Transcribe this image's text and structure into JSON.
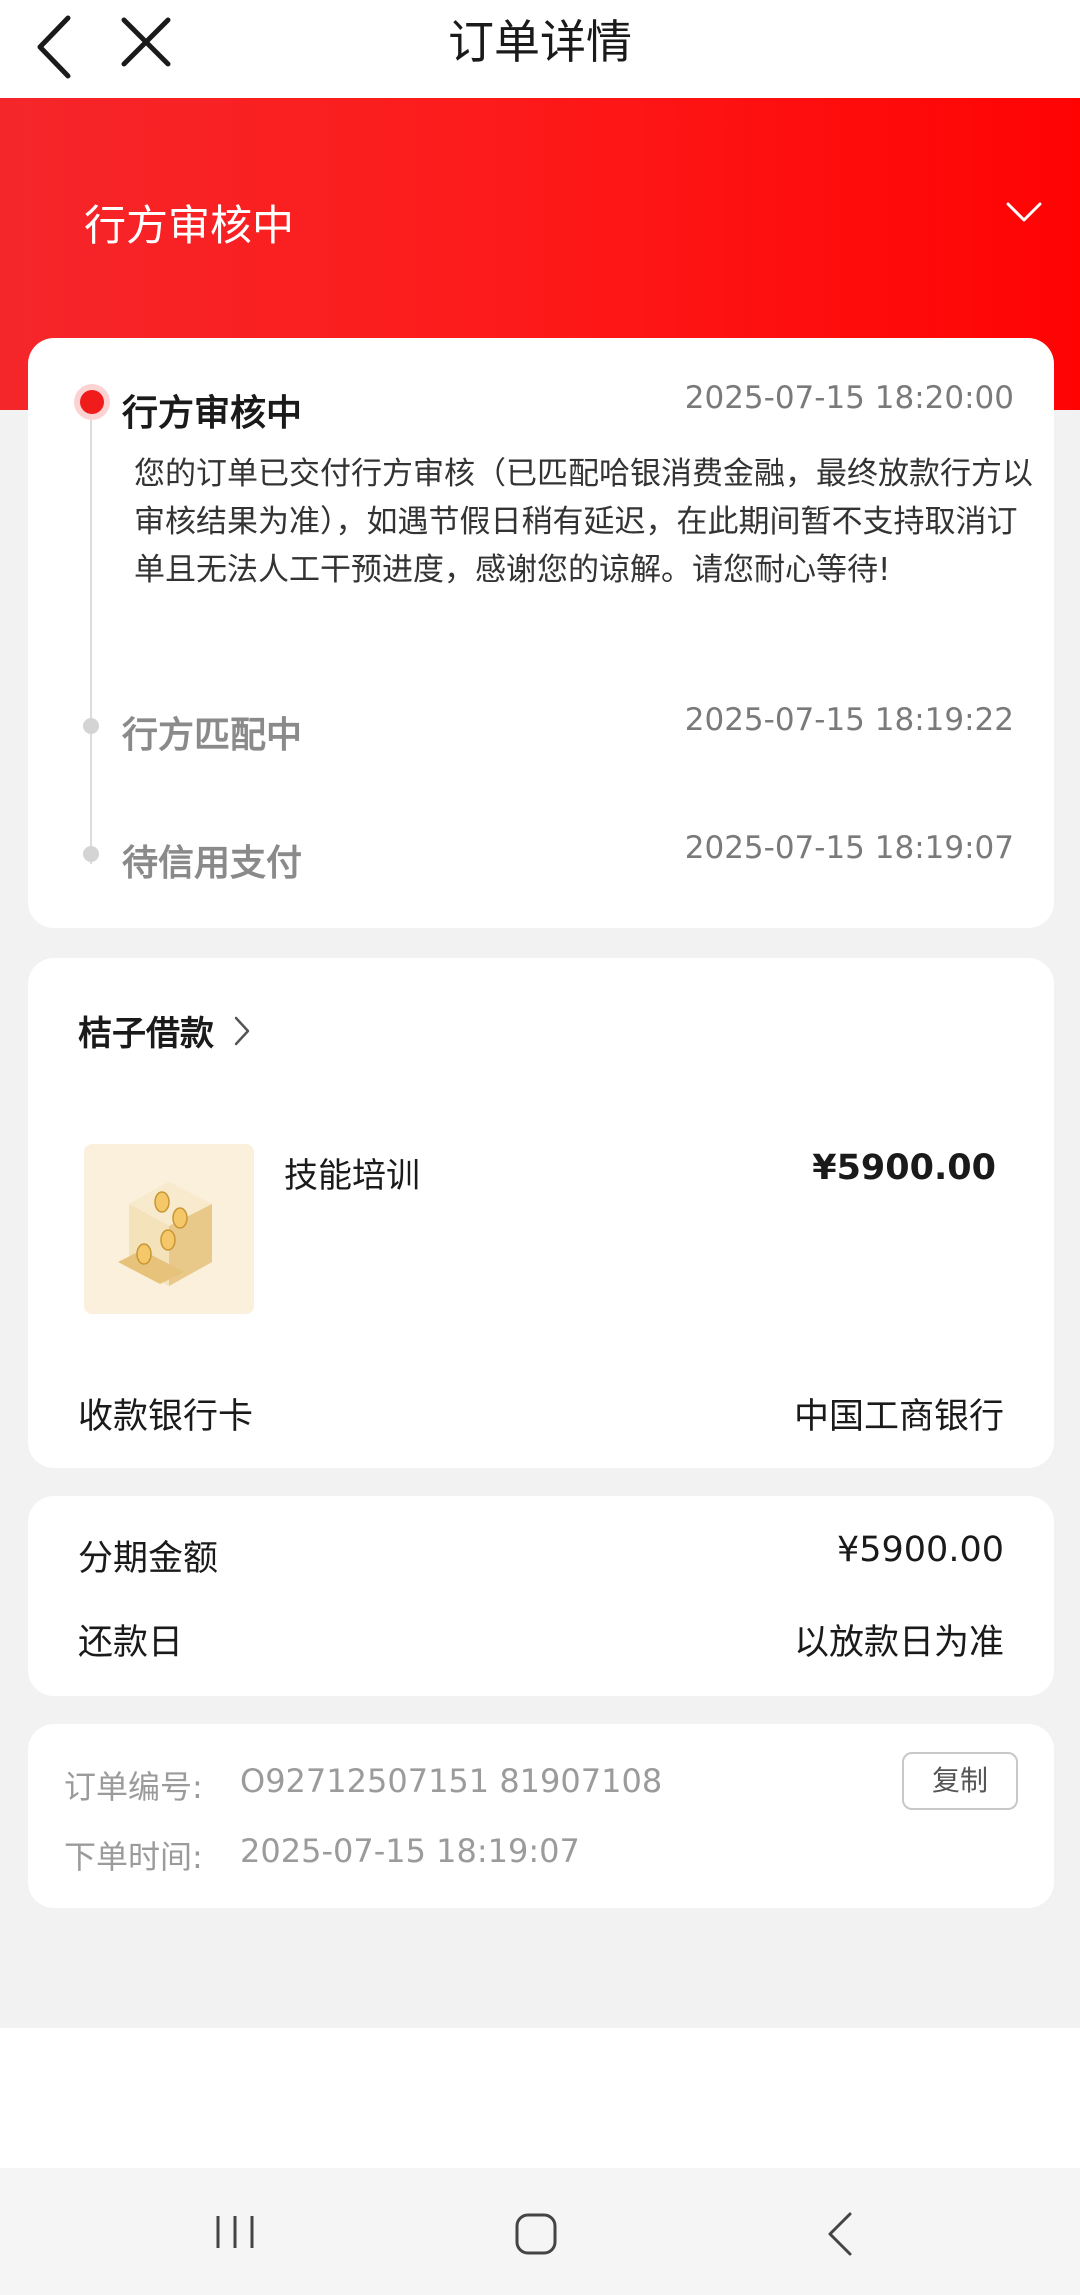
{
  "header": {
    "title": "订单详情"
  },
  "banner": {
    "status": "行方审核中"
  },
  "timeline": {
    "steps": [
      {
        "label": "行方审核中",
        "time": "2025-07-15 18:20:00",
        "description": "您的订单已交付行方审核（已匹配哈银消费金融，最终放款行方以审核结果为准），如遇节假日稍有延迟，在此期间暂不支持取消订单且无法人工干预进度，感谢您的谅解。请您耐心等待!"
      },
      {
        "label": "行方匹配中",
        "time": "2025-07-15 18:19:22"
      },
      {
        "label": "待信用支付",
        "time": "2025-07-15 18:19:07"
      }
    ]
  },
  "product": {
    "merchant": "桔子借款",
    "name": "技能培训",
    "price": "¥5900.00",
    "bank_label": "收款银行卡",
    "bank_value": "中国工商银行"
  },
  "installment": {
    "amount_label": "分期金额",
    "amount_value": "¥5900.00",
    "repay_label": "还款日",
    "repay_value": "以放款日为准"
  },
  "order": {
    "number_label": "订单编号:",
    "number_value": "O92712507151 81907108",
    "time_label": "下单时间:",
    "time_value": "2025-07-15 18:19:07",
    "copy_label": "复制"
  }
}
